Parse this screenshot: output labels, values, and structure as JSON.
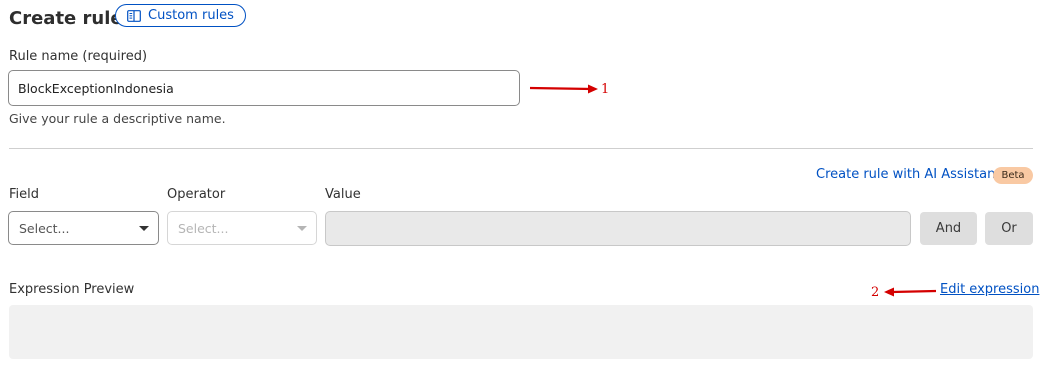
{
  "header": {
    "title": "Create rule",
    "custom_rules_label": "Custom rules",
    "custom_rules_icon": "book-icon"
  },
  "rule_name": {
    "label": "Rule name (required)",
    "value": "BlockExceptionIndonesia",
    "hint": "Give your rule a descriptive name."
  },
  "ai_assistant": {
    "link_label": "Create rule with AI Assistant",
    "badge": "Beta"
  },
  "builder": {
    "field_label": "Field",
    "field_placeholder": "Select...",
    "operator_label": "Operator",
    "operator_placeholder": "Select...",
    "value_label": "Value",
    "value": "",
    "and_label": "And",
    "or_label": "Or"
  },
  "expression": {
    "label": "Expression Preview",
    "edit_label": "Edit expression",
    "preview_text": ""
  },
  "annotations": [
    {
      "number": "1",
      "color": "#d40000"
    },
    {
      "number": "2",
      "color": "#d40000"
    }
  ],
  "colors": {
    "link": "#0051c3",
    "beta_badge": "#f9c9a3",
    "annotation": "#d40000"
  }
}
